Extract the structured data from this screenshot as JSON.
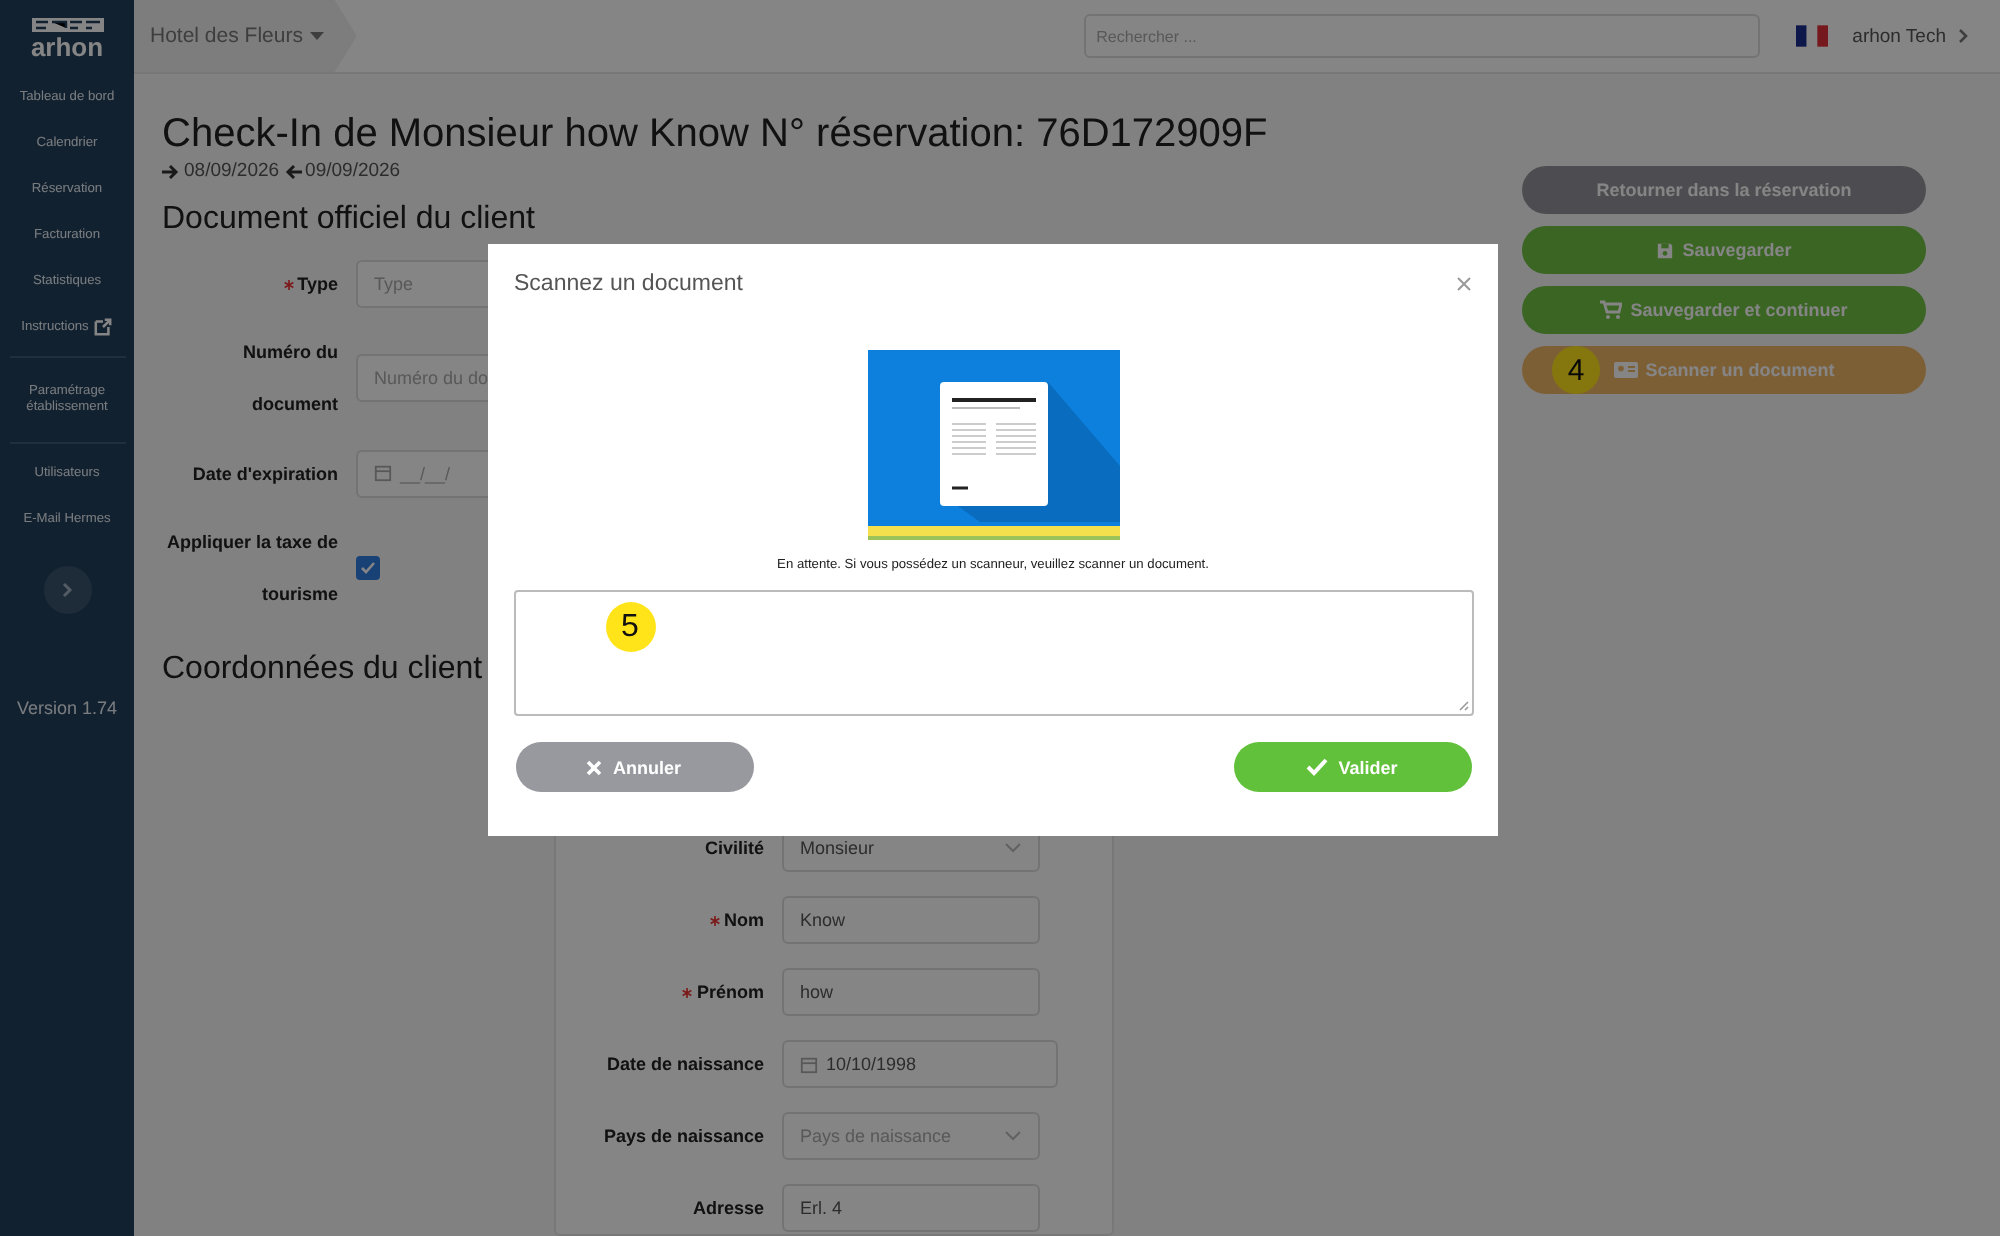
{
  "sidebar": {
    "brand": "arhon",
    "groups": [
      {
        "items": [
          {
            "label": "Tableau de bord"
          },
          {
            "label": "Calendrier"
          },
          {
            "label": "Réservation"
          },
          {
            "label": "Facturation"
          },
          {
            "label": "Statistiques"
          },
          {
            "label": "Instructions",
            "external": true
          }
        ]
      },
      {
        "items": [
          {
            "label": "Paramétrage établissement"
          }
        ]
      },
      {
        "items": [
          {
            "label": "Utilisateurs"
          },
          {
            "label": "E-Mail Hermes"
          }
        ]
      }
    ],
    "version": "Version 1.74"
  },
  "topbar": {
    "hotel": "Hotel des Fleurs",
    "search_placeholder": "Rechercher ...",
    "user": "arhon Tech"
  },
  "page": {
    "title": "Check-In de Monsieur how Know N° réservation: 76D172909F",
    "arrival": "08/09/2026",
    "departure": "09/09/2026",
    "document_section": {
      "heading": "Document officiel du client",
      "fields": [
        {
          "kind": "text",
          "label": "Type",
          "required": true,
          "placeholder": "Type"
        },
        {
          "kind": "text",
          "label": "Numéro du document",
          "required": false,
          "placeholder": "Numéro du do"
        },
        {
          "kind": "date",
          "label": "Date d'expiration",
          "required": false,
          "placeholder": "__/__/"
        },
        {
          "kind": "checkbox",
          "label": "Appliquer la taxe de tourisme",
          "required": false,
          "checked": true
        }
      ]
    },
    "client_section": {
      "heading": "Coordonnées du client",
      "fields": [
        {
          "kind": "select",
          "label": "Civilité",
          "required": false,
          "value": "Monsieur"
        },
        {
          "kind": "text",
          "label": "Nom",
          "required": true,
          "value": "Know"
        },
        {
          "kind": "text",
          "label": "Prénom",
          "required": true,
          "value": "how"
        },
        {
          "kind": "date",
          "label": "Date de naissance",
          "required": false,
          "value": "10/10/1998"
        },
        {
          "kind": "select",
          "label": "Pays de naissance",
          "required": false,
          "placeholder": "Pays de naissance"
        },
        {
          "kind": "text",
          "label": "Adresse",
          "required": false,
          "value": "Erl. 4"
        }
      ]
    },
    "actions": [
      {
        "kind": "back",
        "label": "Retourner dans la réservation"
      },
      {
        "kind": "save",
        "label": "Sauvegarder"
      },
      {
        "kind": "save_continue",
        "label": "Sauvegarder et continuer"
      },
      {
        "kind": "scan",
        "label": "Scanner un document",
        "marker": "4"
      }
    ]
  },
  "modal": {
    "title": "Scannez un document",
    "status": "En attente. Si vous possédez un scanneur, veuillez scanner un document.",
    "textarea_marker": "5",
    "buttons": [
      {
        "kind": "cancel",
        "label": "Annuler"
      },
      {
        "kind": "validate",
        "label": "Valider"
      }
    ]
  }
}
